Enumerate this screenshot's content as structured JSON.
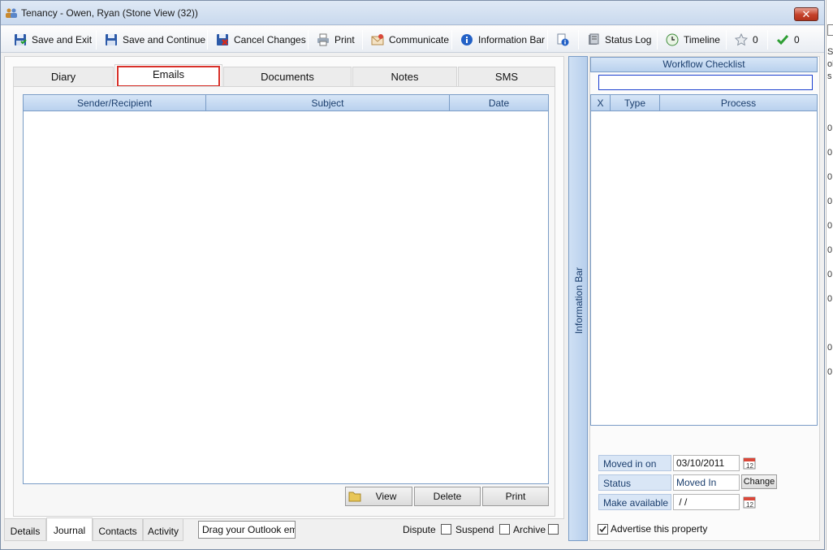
{
  "window": {
    "title": "Tenancy - Owen, Ryan (Stone View (32))",
    "close_label": "✕"
  },
  "toolbar": {
    "save_exit": "Save and Exit",
    "save_continue": "Save and Continue",
    "cancel_changes": "Cancel Changes",
    "print": "Print",
    "communicate": "Communicate",
    "information_bar": "Information Bar",
    "status_log": "Status Log",
    "timeline": "Timeline",
    "star_count": "0",
    "check_count": "0"
  },
  "tabs": [
    "Diary",
    "Emails",
    "Documents",
    "Notes",
    "SMS"
  ],
  "emails_grid": {
    "columns": [
      "Sender/Recipient",
      "Subject",
      "Date"
    ]
  },
  "grid_buttons": {
    "view": "View",
    "delete": "Delete",
    "print": "Print"
  },
  "bottom_tabs": [
    "Details",
    "Journal",
    "Contacts",
    "Activity"
  ],
  "drag_input": "Drag your Outlook em",
  "checkboxes": {
    "dispute": "Dispute",
    "suspend": "Suspend",
    "archive": "Archive"
  },
  "information_bar_label": "Information Bar",
  "workflow": {
    "title": "Workflow Checklist",
    "columns": [
      "X",
      "Type",
      "Process"
    ]
  },
  "tenancy_info": {
    "moved_in_on_label": "Moved in on",
    "moved_in_on_value": "03/10/2011",
    "status_label": "Status",
    "status_value": "Moved In",
    "change_label": "Change",
    "make_available_label": "Make available",
    "make_available_value": " / /",
    "advertise_label": "Advertise this property",
    "advertise_checked": true
  },
  "edge_text": [
    "Se",
    "ol",
    "s",
    "0",
    "0",
    "0",
    "0",
    "0",
    "0",
    "0",
    "0",
    "0",
    "0"
  ]
}
